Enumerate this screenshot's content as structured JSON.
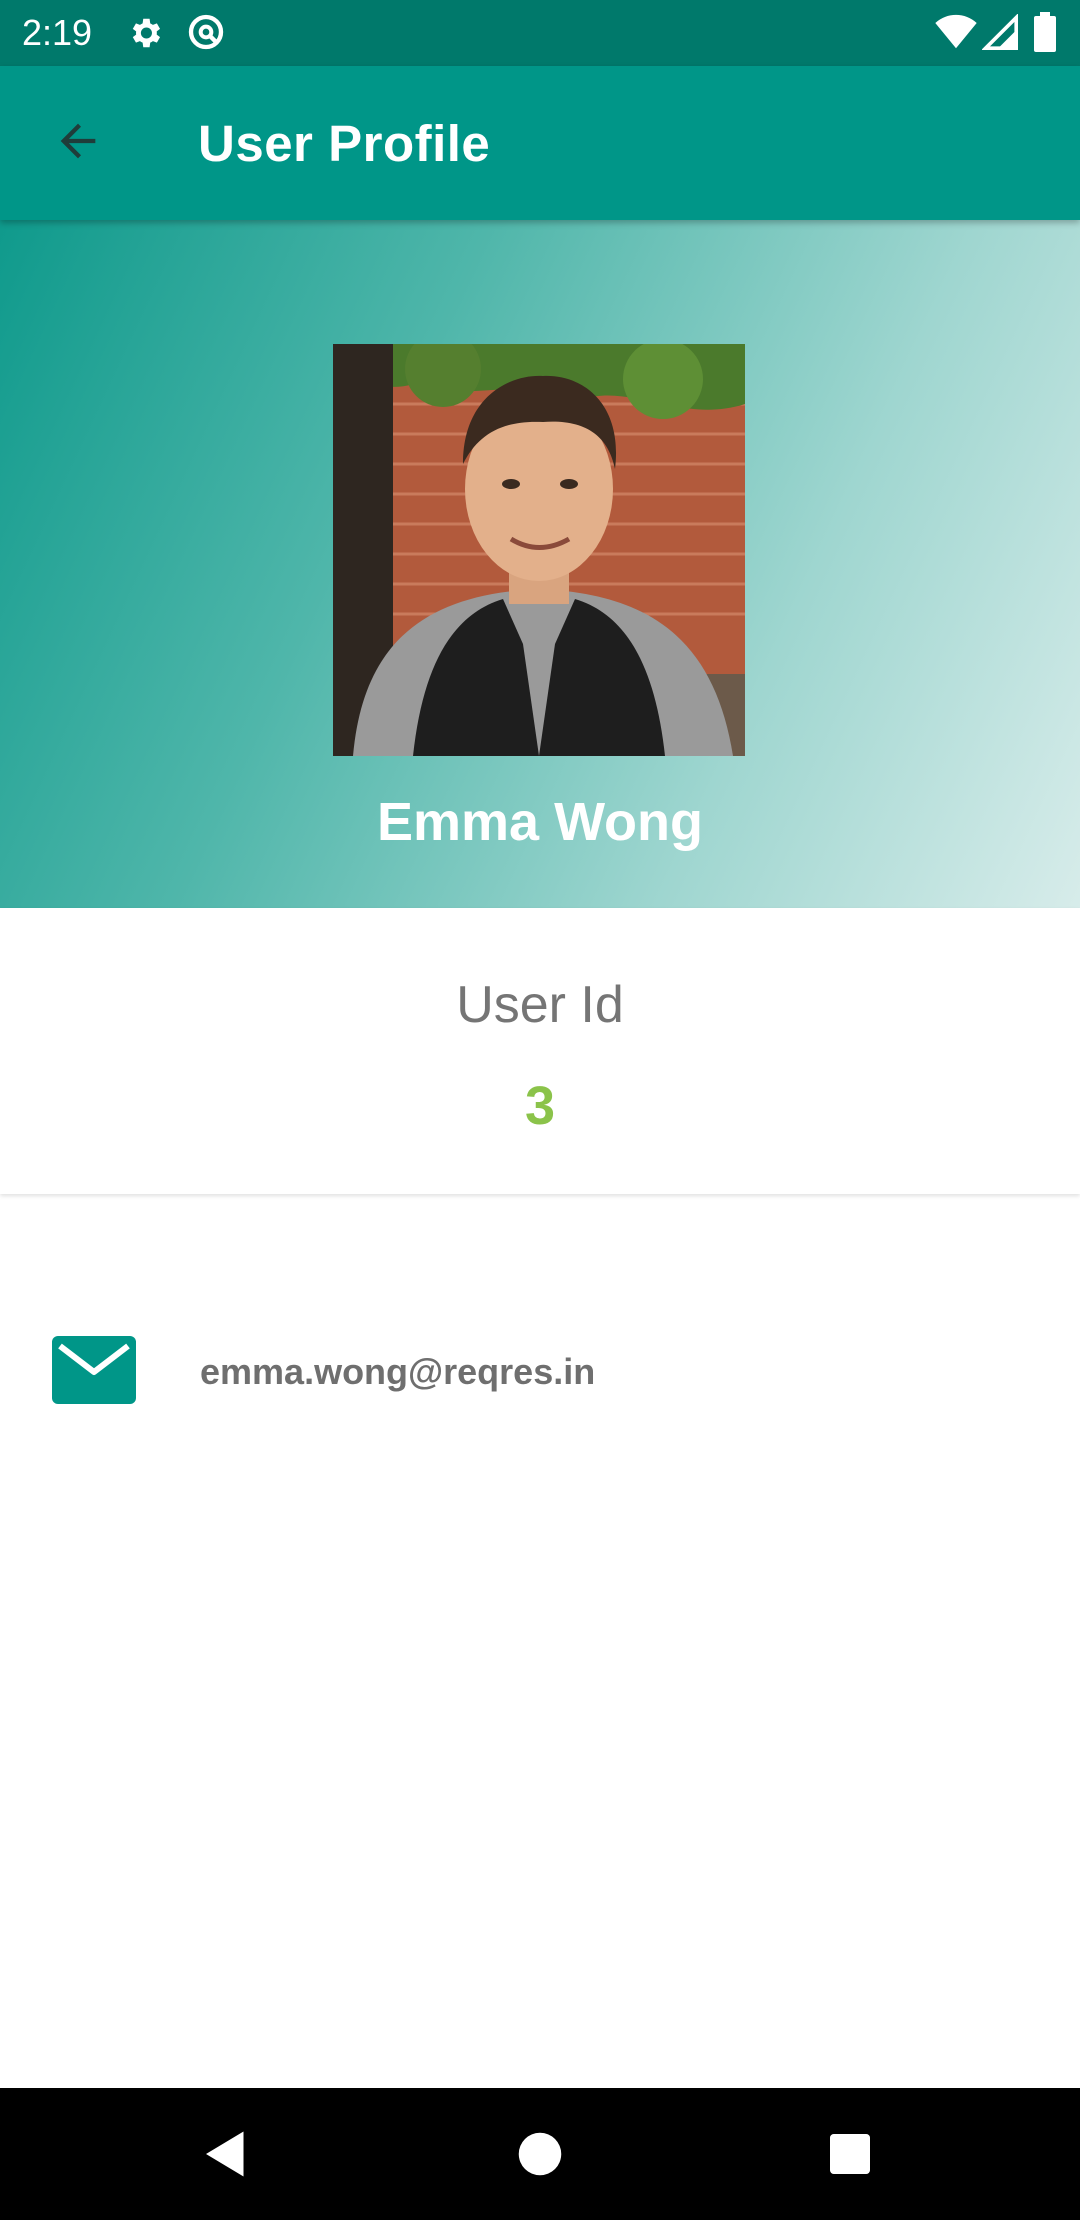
{
  "status_bar": {
    "time": "2:19",
    "left_icons": [
      "gear-icon",
      "at-sign-icon"
    ],
    "right_icons": [
      "wifi-icon",
      "signal-icon",
      "battery-icon"
    ]
  },
  "app_bar": {
    "title": "User Profile",
    "back_icon": "arrow-left-icon",
    "background": "#009688"
  },
  "profile": {
    "name": "Emma Wong",
    "id_label": "User Id",
    "id_value": "3",
    "id_color": "#8bc34a",
    "email": "emma.wong@reqres.in",
    "email_icon": "envelope-icon"
  },
  "nav_bar": {
    "buttons": [
      "back-triangle-icon",
      "home-circle-icon",
      "recents-square-icon"
    ]
  }
}
